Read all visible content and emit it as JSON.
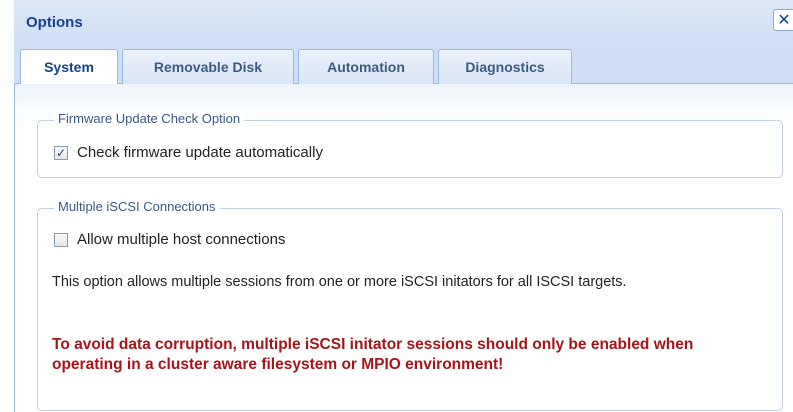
{
  "window": {
    "title": "Options",
    "close_glyph": "✕",
    "close_icon": "close-icon"
  },
  "tabs": [
    {
      "label": "System",
      "active": true
    },
    {
      "label": "Removable Disk",
      "active": false
    },
    {
      "label": "Automation",
      "active": false
    },
    {
      "label": "Diagnostics",
      "active": false
    }
  ],
  "firmware_group": {
    "legend": "Firmware Update Check Option",
    "checkbox_label": "Check firmware update automatically",
    "checked": true,
    "check_glyph": "✓"
  },
  "iscsi_group": {
    "legend": "Multiple iSCSI Connections",
    "checkbox_label": "Allow multiple host connections",
    "checked": false,
    "description": "This option allows multiple sessions from one or more iSCSI initators for all ISCSI targets.",
    "warning": "To avoid data corruption, multiple iSCSI initator sessions should only be enabled when operating in a cluster aware filesystem or MPIO environment!"
  },
  "colors": {
    "title_text": "#15428b",
    "warning_text": "#a8141a",
    "tab_border": "#99bbe8"
  }
}
